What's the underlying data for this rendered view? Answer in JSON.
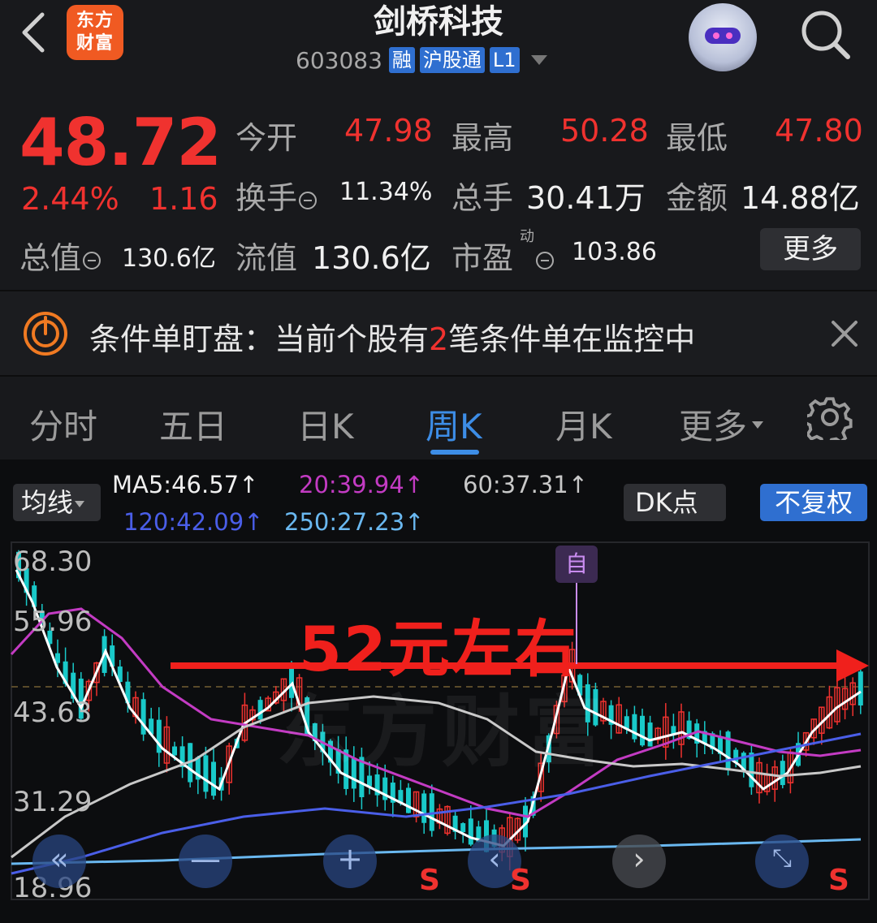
{
  "header": {
    "logo_text": "东方财富",
    "title": "剑桥科技",
    "code": "603083",
    "tags": [
      "融",
      "沪股通",
      "L1"
    ]
  },
  "quote": {
    "price": "48.72",
    "pct": "2.44%",
    "change": "1.16",
    "open_label": "今开",
    "open": "47.98",
    "high_label": "最高",
    "high": "50.28",
    "low_label": "最低",
    "low": "47.80",
    "turnover_label": "换手",
    "turnover": "11.34%",
    "volume_label": "总手",
    "volume": "30.41万",
    "amount_label": "金额",
    "amount": "14.88亿",
    "mcap_label": "总值",
    "mcap": "130.6亿",
    "float_label": "流值",
    "float": "130.6亿",
    "pe_label": "市盈",
    "pe_sup": "动",
    "pe": "103.86",
    "more_label": "更多"
  },
  "banner": {
    "prefix": "条件单盯盘：当前个股有",
    "count": "2",
    "suffix": "笔条件单在监控中"
  },
  "tabs": {
    "items": [
      "分时",
      "五日",
      "日K",
      "周K",
      "月K",
      "更多"
    ],
    "active": "周K"
  },
  "chart": {
    "ma_button": "均线",
    "ma5": "MA5:46.57↑",
    "ma20": "20:39.94↑",
    "ma60": "60:37.31↑",
    "ma120": "120:42.09↑",
    "ma250": "250:27.23↑",
    "dk_button": "DK点",
    "adjust_button": "不复权",
    "y_labels": [
      "68.30",
      "55.96",
      "43.63",
      "31.29",
      "18.96"
    ],
    "zi_label": "自",
    "annotation": "52元左右",
    "watermark": "东方财富",
    "s_marks": [
      "S",
      "S",
      "S"
    ],
    "colors": {
      "up": "#f0322f",
      "down": "#19c9c9",
      "ma5": "#ffffff",
      "ma20": "#c33bc3",
      "ma60": "#c8c8c8",
      "ma120": "#4a5ee8",
      "ma250": "#6ab8f0"
    }
  }
}
